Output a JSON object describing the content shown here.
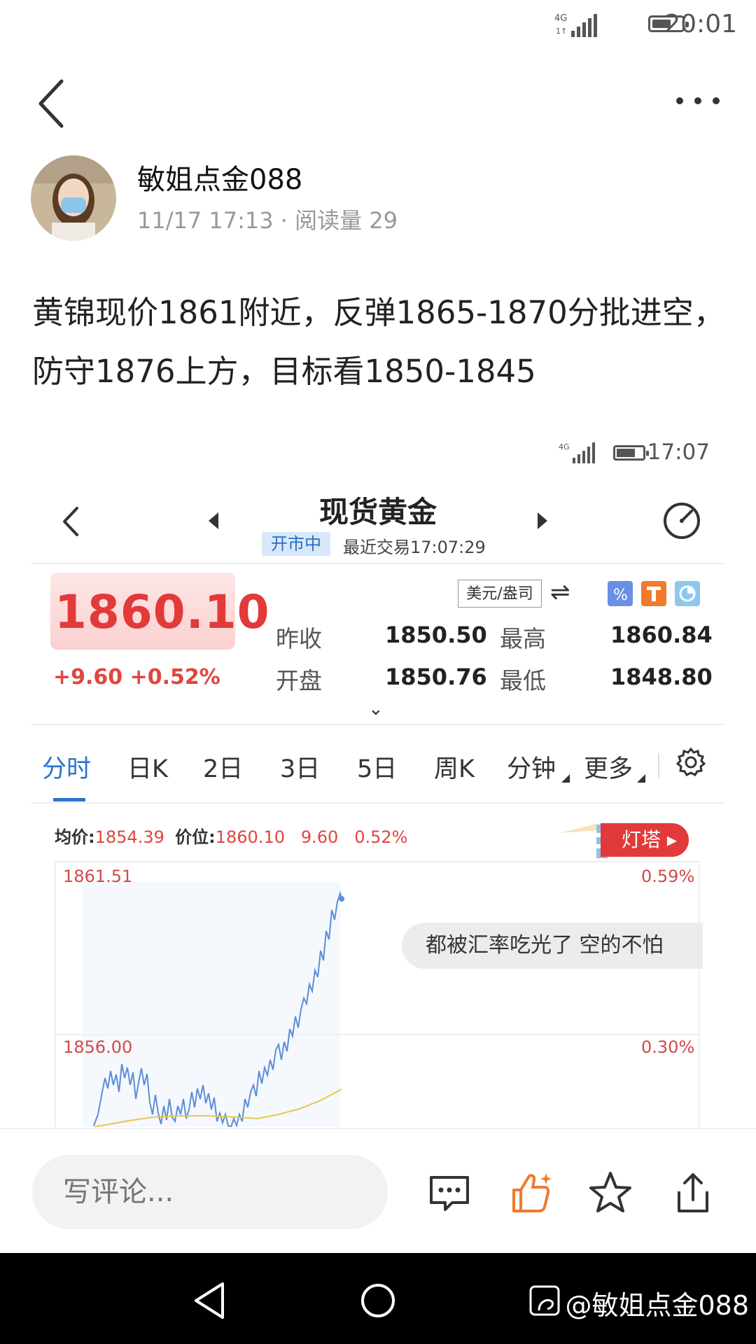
{
  "status_bar": {
    "network": "4G",
    "time": "20:01"
  },
  "post": {
    "author": "敏姐点金088",
    "meta": "11/17 17:13 · 阅读量 29",
    "text": "黄锦现价1861附近，反弹1865-1870分批进空，防守1876上方，目标看1850-1845"
  },
  "embedded": {
    "status_time": "17:07",
    "title": "现货黄金",
    "market_status": "开市中",
    "last_trade": "最近交易17:07:29",
    "price": "1860.10",
    "change": "+9.60  +0.52%",
    "unit_label": "美元/盎司",
    "stats": {
      "prev_close_label": "昨收",
      "prev_close": "1850.50",
      "high_label": "最高",
      "high": "1860.84",
      "open_label": "开盘",
      "open": "1850.76",
      "low_label": "最低",
      "low": "1848.80"
    },
    "tabs": [
      "分时",
      "日K",
      "2日",
      "3日",
      "5日",
      "周K",
      "分钟",
      "更多"
    ],
    "active_tab": "分时",
    "avg_label": "均价:",
    "avg_value": "1854.39",
    "price_label": "价位:",
    "price_value": "1860.10",
    "diff_value": "9.60",
    "pct_value": "0.52%",
    "lighthouse_label": "灯塔",
    "axis_top_left": "1861.51",
    "axis_top_right": "0.59%",
    "axis_mid_left": "1856.00",
    "axis_mid_right": "0.30%",
    "comment_bubble": "都被汇率吃光了 空的不怕"
  },
  "comment_bar": {
    "placeholder": "写评论..."
  },
  "watermark": "@敏姐点金088",
  "colors": {
    "accent_blue": "#2b73cf",
    "price_red": "#e23a3a",
    "like_orange": "#f07a2e"
  }
}
